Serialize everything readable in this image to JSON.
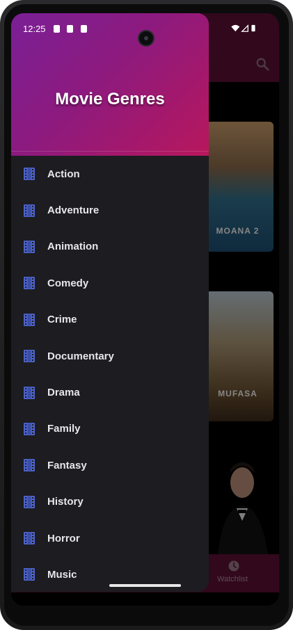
{
  "status_bar": {
    "time": "12:25"
  },
  "drawer": {
    "title": "Movie Genres",
    "genres": [
      "Action",
      "Adventure",
      "Animation",
      "Comedy",
      "Crime",
      "Documentary",
      "Drama",
      "Family",
      "Fantasy",
      "History",
      "Horror",
      "Music"
    ]
  },
  "background": {
    "posters": [
      {
        "title": "MOANA 2"
      },
      {
        "title": "MUFASA"
      }
    ],
    "bottom_nav": {
      "watchlist_label": "Watchlist"
    }
  },
  "colors": {
    "accent": "#b8175c",
    "drawer_bg": "#1c1c21",
    "icon": "#4d63c9"
  },
  "icons": [
    "film-icon",
    "search-icon",
    "clock-icon"
  ]
}
